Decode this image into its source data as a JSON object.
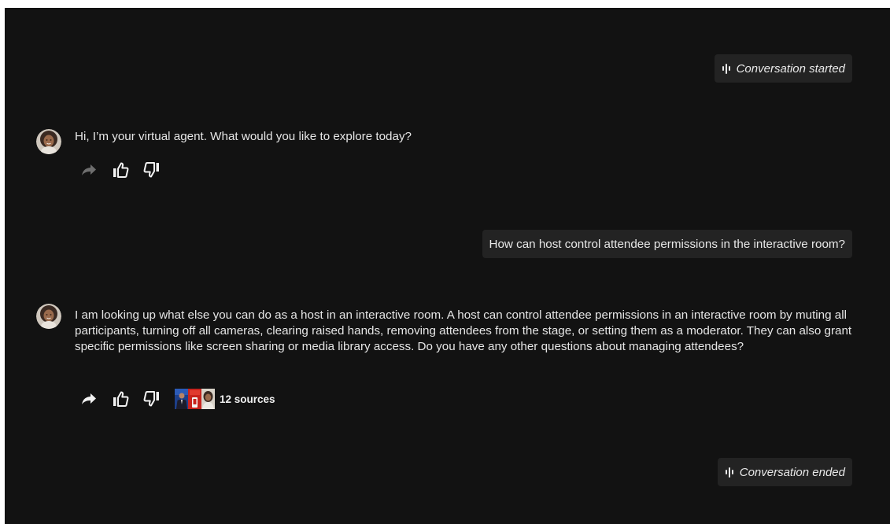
{
  "conversation": {
    "started_label": "Conversation started",
    "ended_label": "Conversation ended"
  },
  "messages": [
    {
      "role": "agent",
      "text": "Hi, I’m your virtual agent. What would you like to explore today?"
    },
    {
      "role": "user",
      "text": "How can host control attendee permissions in the interactive room?"
    },
    {
      "role": "agent",
      "text": "I am looking up what else you can do as a host in an interactive room. A host can control attendee permissions in an interactive room by muting all participants, turning off all cameras, clearing raised hands, removing attendees from the stage, or setting them as a moderator. They can also grant specific permissions like screen sharing or media library access. Do you have any other questions about managing attendees?"
    }
  ],
  "sources": {
    "label": "12 sources"
  },
  "icons": {
    "status": "voice-waveform-icon",
    "share": "share-arrow-icon",
    "like": "thumbs-up-icon",
    "dislike": "thumbs-down-icon"
  },
  "colors": {
    "background": "#121212",
    "bubble": "#232323",
    "text": "#e6e6e6",
    "disabled_icon": "#7a7a7a"
  }
}
